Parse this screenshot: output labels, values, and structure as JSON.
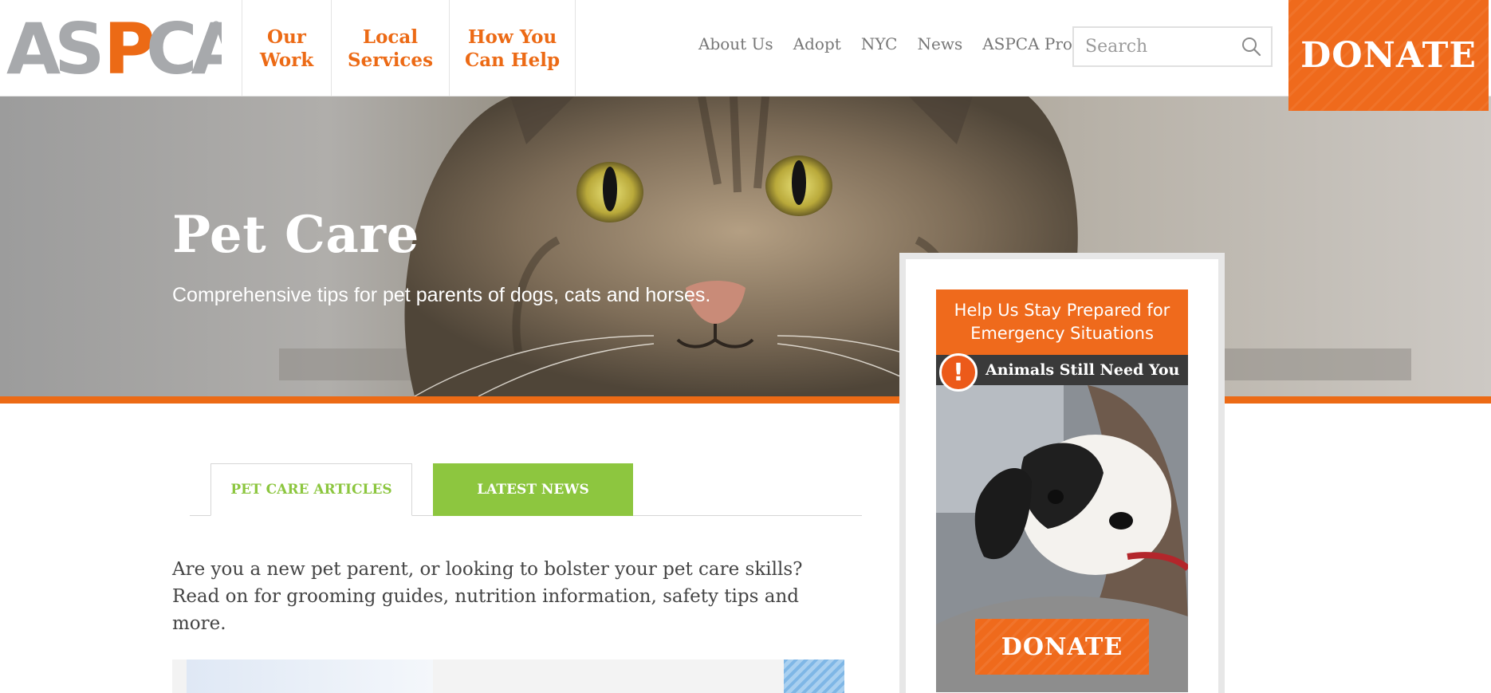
{
  "header": {
    "logo_text": "ASPCA",
    "nav": [
      {
        "label": "Our Work",
        "lines": [
          "Our",
          "Work"
        ]
      },
      {
        "label": "Local Services",
        "lines": [
          "Local",
          "Services"
        ]
      },
      {
        "label": "How You Can Help",
        "lines": [
          "How You",
          "Can Help"
        ]
      }
    ],
    "utility_links": [
      "About Us",
      "Adopt",
      "NYC",
      "News",
      "ASPCA Pro"
    ],
    "search_placeholder": "Search",
    "donate_label": "DONATE"
  },
  "hero": {
    "title": "Pet Care",
    "subtitle": "Comprehensive tips for pet parents of dogs, cats and horses."
  },
  "tabs": [
    {
      "label": "PET CARE ARTICLES",
      "active": true
    },
    {
      "label": "LATEST NEWS",
      "active": false
    }
  ],
  "intro_text": "Are you a new pet parent, or looking to bolster your pet care skills? Read on for grooming guides, nutrition information, safety tips and more.",
  "ad": {
    "headline": "Help Us Stay Prepared for Emergency Situations",
    "headline_lines": [
      "Help Us Stay Prepared for",
      "Emergency Situations"
    ],
    "alert_icon": "!",
    "banner": "Animals Still Need You",
    "donate_label": "DONATE"
  },
  "colors": {
    "brand_orange": "#ec6a15",
    "tab_green": "#8dc63f",
    "logo_gray": "#a7a9ac"
  }
}
